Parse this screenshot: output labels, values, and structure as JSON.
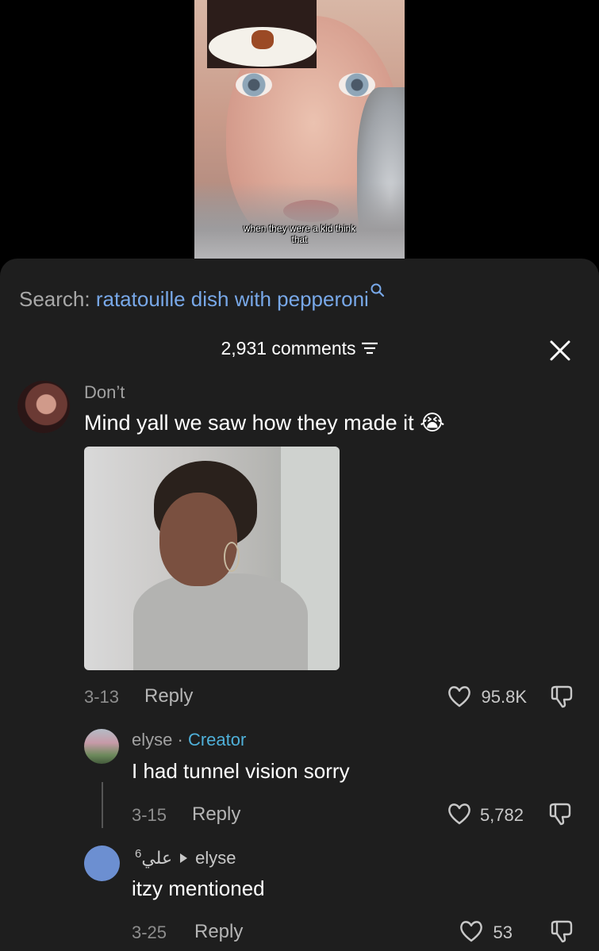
{
  "video": {
    "caption_line1": "when they were a kid think",
    "caption_line2": "that"
  },
  "search": {
    "prefix": "Search:",
    "term": "ratatouille dish with pepperoni",
    "icon": "search-icon"
  },
  "comments_header": {
    "count_label": "2,931 comments",
    "filter_icon": "filter-icon",
    "close_icon": "close-icon"
  },
  "comments": [
    {
      "username": "Don’t",
      "text": "Mind yall we saw how they made it 😭",
      "has_gif": true,
      "date": "3-13",
      "reply_label": "Reply",
      "likes": "95.8K"
    }
  ],
  "replies": [
    {
      "username": "elyse",
      "separator": "·",
      "badge": "Creator",
      "text": "I had tunnel vision sorry",
      "date": "3-15",
      "reply_label": "Reply",
      "likes": "5,782"
    },
    {
      "username": "علي",
      "superscript": "6",
      "reply_to": "elyse",
      "text": "itzy mentioned",
      "date": "3-25",
      "reply_label": "Reply",
      "likes": "53"
    }
  ],
  "colors": {
    "sheet_bg": "#1e1e1e",
    "search_term": "#78a8e8",
    "creator_badge": "#4fb0d9",
    "avatar_blue": "#6c8fd1"
  }
}
